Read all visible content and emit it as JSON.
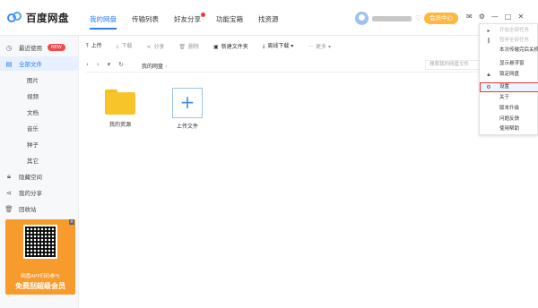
{
  "app": {
    "name": "百度网盘"
  },
  "tabs": [
    {
      "label": "我的网盘"
    },
    {
      "label": "传输列表"
    },
    {
      "label": "好友分享"
    },
    {
      "label": "功能宝箱"
    },
    {
      "label": "找资源"
    }
  ],
  "header": {
    "vip_label": "会员中心"
  },
  "sidebar": {
    "items": [
      {
        "label": "最近使用",
        "badge": "NEW"
      },
      {
        "label": "全部文件"
      },
      {
        "label": "图片"
      },
      {
        "label": "视频"
      },
      {
        "label": "文档"
      },
      {
        "label": "音乐"
      },
      {
        "label": "种子"
      },
      {
        "label": "其它"
      },
      {
        "label": "隐藏空间"
      },
      {
        "label": "我的分享"
      },
      {
        "label": "回收站"
      }
    ]
  },
  "promo": {
    "line1": "网盘APP扫码参与",
    "line2": "免费刮超级会员"
  },
  "toolbar": {
    "upload": "上传",
    "download": "下载",
    "share": "分享",
    "delete": "删除",
    "new_folder": "新建文件夹",
    "offline": "离线下载",
    "more": "更多"
  },
  "address": {
    "crumb": "我的网盘",
    "search_placeholder": "搜索我的网盘文件"
  },
  "files": [
    {
      "name": "我的资源"
    },
    {
      "name": "上传文件"
    }
  ],
  "menu": {
    "items": [
      {
        "label": "开始全部任务",
        "disabled": true
      },
      {
        "label": "暂停全部任务",
        "disabled": true
      },
      {
        "label": "本次传输完后关机"
      },
      {
        "label": "显示悬浮窗"
      },
      {
        "label": "锁定网盘"
      },
      {
        "label": "设置",
        "highlight": true
      },
      {
        "label": "关于"
      },
      {
        "label": "版本升级"
      },
      {
        "label": "问题反馈"
      },
      {
        "label": "使用帮助"
      }
    ]
  },
  "icons": {
    "logo": "cloud-logo",
    "accent": "#2b7cff",
    "vip_color": "#ffb83d",
    "highlight": "#e63b3b"
  }
}
